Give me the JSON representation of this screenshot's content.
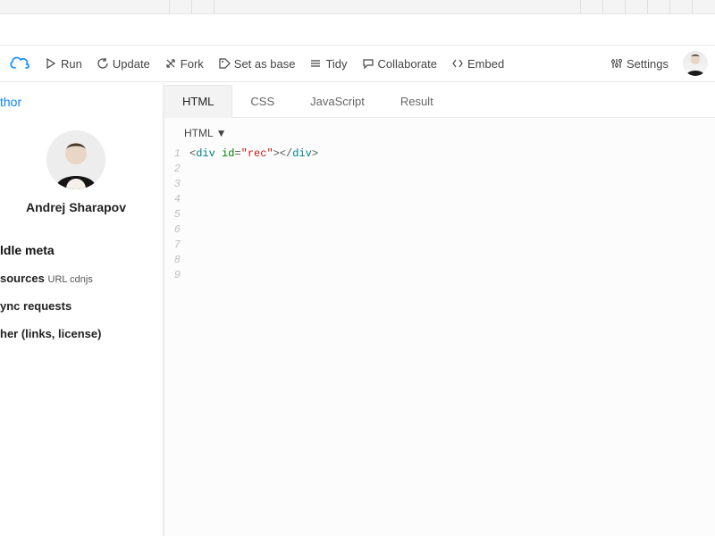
{
  "toolbar": {
    "run": "Run",
    "update": "Update",
    "fork": "Fork",
    "setbase": "Set as base",
    "tidy": "Tidy",
    "collaborate": "Collaborate",
    "embed": "Embed",
    "settings": "Settings"
  },
  "sidebar": {
    "author_heading": "thor",
    "author_name": "Andrej Sharapov",
    "meta_heading": "ldle meta",
    "resources_label": "sources",
    "resources_sub": "URL cdnjs",
    "async_label": "ync requests",
    "other_label": "her (links, license)"
  },
  "tabs": {
    "html": "HTML",
    "css": "CSS",
    "js": "JavaScript",
    "result": "Result"
  },
  "editor": {
    "lang_label": "HTML",
    "line_numbers": [
      "1",
      "2",
      "3",
      "4",
      "5",
      "6",
      "7",
      "8",
      "9"
    ],
    "code_tokens": {
      "open": "<",
      "tag1": "div",
      "sp": " ",
      "attr": "id",
      "eq": "=",
      "q1": "\"",
      "val": "rec",
      "q2": "\"",
      "close1": ">",
      "open2": "</",
      "tag2": "div",
      "close2": ">"
    }
  }
}
